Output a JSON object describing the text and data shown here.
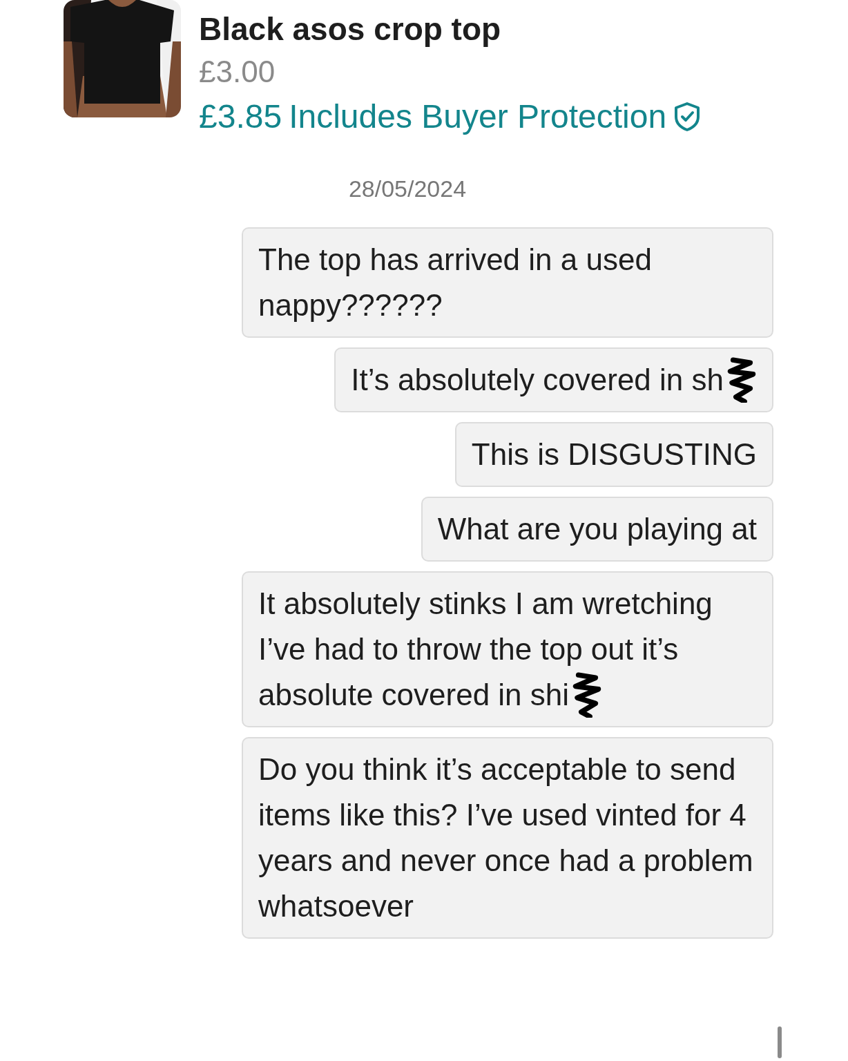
{
  "item": {
    "kind": "picture",
    "title": "Black asos crop top",
    "price": "£3.00",
    "total": "£3.85",
    "protection": "Includes Buyer Protection"
  },
  "date": "28/05/2024",
  "messages": [
    {
      "text": "The top has arrived in a used nappy??????",
      "redacted": false
    },
    {
      "text": "It’s absolutely covered in sh",
      "redacted": true
    },
    {
      "text": "This is DISGUSTING",
      "redacted": false
    },
    {
      "text": "What are you playing at",
      "redacted": false
    },
    {
      "text": "It absolutely stinks I am wretching\nI’ve had to throw the top out it’s absolute covered in shi",
      "redacted": true
    },
    {
      "text": "Do you think it’s acceptable to send items like this? I’ve used vinted for 4 years and never once had a problem whatsoever",
      "redacted": false
    }
  ]
}
